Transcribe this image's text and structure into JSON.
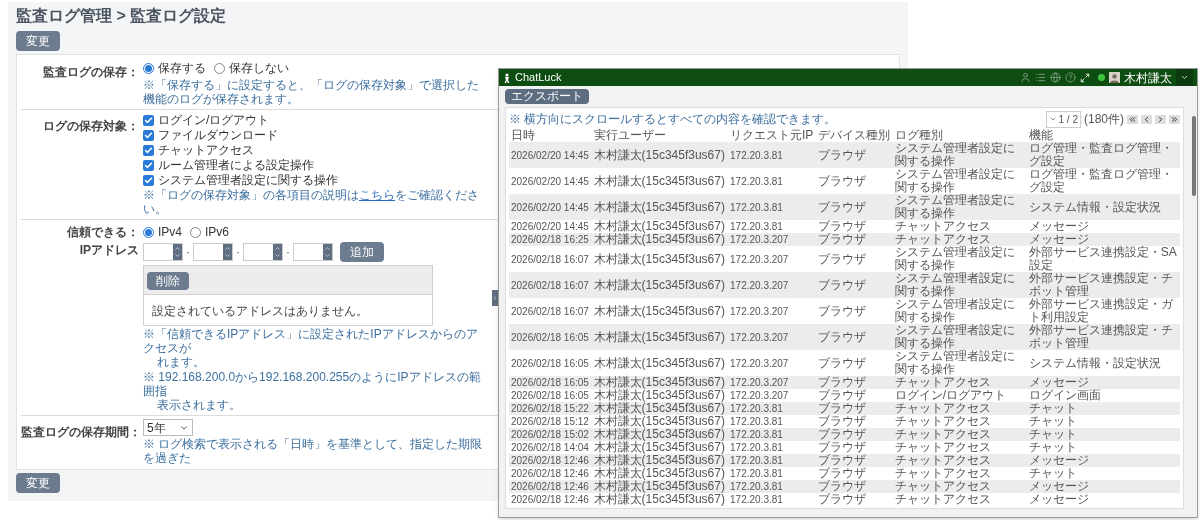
{
  "settings": {
    "title": "監査ログ管理 > 監査ログ設定",
    "top_button": "変更",
    "bottom_button": "変更",
    "save": {
      "label": "監査ログの保存：",
      "options": [
        {
          "label": "保存する",
          "selected": true
        },
        {
          "label": "保存しない",
          "selected": false
        }
      ],
      "note": "※「保存する」に設定すると、「ログの保存対象」で選択した機能のログが保存されます。"
    },
    "targets": {
      "label": "ログの保存対象：",
      "items": [
        {
          "label": "ログイン/ログアウト",
          "checked": true
        },
        {
          "label": "ファイルダウンロード",
          "checked": true
        },
        {
          "label": "チャットアクセス",
          "checked": true
        },
        {
          "label": "ルーム管理者による設定操作",
          "checked": true
        },
        {
          "label": "システム管理者設定に関する操作",
          "checked": true
        }
      ],
      "note": {
        "before": "※「ログの保存対象」の各項目の説明は",
        "link": "こちら",
        "after": "をご確認ください。"
      }
    },
    "ip": {
      "label_lines": [
        "信頼できる：",
        "IPアドレス"
      ],
      "options": [
        {
          "label": "IPv4",
          "selected": true
        },
        {
          "label": "IPv6",
          "selected": false
        }
      ],
      "separators": [
        "·",
        "·",
        "·"
      ],
      "add_button": "追加",
      "delete_button": "削除",
      "empty_message": "設定されているアドレスはありません。",
      "notes": [
        [
          "※「信頼できるIPアドレス」に設定されたIPアドレスからのアクセスが",
          "れます。"
        ],
        [
          "※ 192.168.200.0から192.168.200.255のようにIPアドレスの範囲指",
          "表示されます。"
        ]
      ]
    },
    "period": {
      "label": "監査ログの保存期間：",
      "value": "5年",
      "note": "※ ログ検索で表示される「日時」を基準として、指定した期限を過ぎた"
    }
  },
  "window": {
    "app_name": "ChatLuck",
    "user_name": "木村謙太",
    "export_button": "エクスポート",
    "scroll_note": "※ 横方向にスクロールするとすべての内容を確認できます。",
    "page_select": "1 / 2",
    "total": "(180件)",
    "table": {
      "columns": [
        "日時",
        "実行ユーザー",
        "リクエスト元IP",
        "デバイス種別",
        "ログ種別",
        "機能"
      ],
      "rows": [
        {
          "cells": [
            "2026/02/20 14:45",
            "木村謙太(15c345f3us67)",
            "172.20.3.81",
            "ブラウザ",
            "システム管理者設定に関する操作"
          ],
          "function": [
            "ログ管理・監査ログ管理・",
            "グ設定"
          ]
        },
        {
          "cells": [
            "2026/02/20 14:45",
            "木村謙太(15c345f3us67)",
            "172.20.3.81",
            "ブラウザ",
            "システム管理者設定に関する操作"
          ],
          "function": [
            "ログ管理・監査ログ管理・",
            "グ設定"
          ]
        },
        {
          "cells": [
            "2026/02/20 14:45",
            "木村謙太(15c345f3us67)",
            "172.20.3.81",
            "ブラウザ",
            "システム管理者設定に関する操作"
          ],
          "function": [
            "システム情報・設定状況"
          ]
        },
        {
          "cells": [
            "2026/02/20 14:45",
            "木村謙太(15c345f3us67)",
            "172.20.3.81",
            "ブラウザ",
            "チャットアクセス"
          ],
          "function": [
            "メッセージ"
          ]
        },
        {
          "cells": [
            "2026/02/18 16:25",
            "木村謙太(15c345f3us67)",
            "172.20.3.207",
            "ブラウザ",
            "チャットアクセス"
          ],
          "function": [
            "メッセージ"
          ]
        },
        {
          "cells": [
            "2026/02/18 16:07",
            "木村謙太(15c345f3us67)",
            "172.20.3.207",
            "ブラウザ",
            "システム管理者設定に関する操作"
          ],
          "function": [
            "外部サービス連携設定・SA",
            "設定"
          ]
        },
        {
          "cells": [
            "2026/02/18 16:07",
            "木村謙太(15c345f3us67)",
            "172.20.3.207",
            "ブラウザ",
            "システム管理者設定に関する操作"
          ],
          "function": [
            "外部サービス連携設定・チ",
            "ボット管理"
          ]
        },
        {
          "cells": [
            "2026/02/18 16:07",
            "木村謙太(15c345f3us67)",
            "172.20.3.207",
            "ブラウザ",
            "システム管理者設定に関する操作"
          ],
          "function": [
            "外部サービス連携設定・ガ",
            "ト利用設定"
          ]
        },
        {
          "cells": [
            "2026/02/18 16:05",
            "木村謙太(15c345f3us67)",
            "172.20.3.207",
            "ブラウザ",
            "システム管理者設定に関する操作"
          ],
          "function": [
            "外部サービス連携設定・チ",
            "ボット管理"
          ]
        },
        {
          "cells": [
            "2026/02/18 16:05",
            "木村謙太(15c345f3us67)",
            "172.20.3.207",
            "ブラウザ",
            "システム管理者設定に関する操作"
          ],
          "function": [
            "システム情報・設定状況"
          ]
        },
        {
          "cells": [
            "2026/02/18 16:05",
            "木村謙太(15c345f3us67)",
            "172.20.3.207",
            "ブラウザ",
            "チャットアクセス"
          ],
          "function": [
            "メッセージ"
          ]
        },
        {
          "cells": [
            "2026/02/18 16:05",
            "木村謙太(15c345f3us67)",
            "172.20.3.207",
            "ブラウザ",
            "ログイン/ログアウト"
          ],
          "function": [
            "ログイン画面"
          ]
        },
        {
          "cells": [
            "2026/02/18 15:22",
            "木村謙太(15c345f3us67)",
            "172.20.3.81",
            "ブラウザ",
            "チャットアクセス"
          ],
          "function": [
            "チャット"
          ]
        },
        {
          "cells": [
            "2026/02/18 15:12",
            "木村謙太(15c345f3us67)",
            "172.20.3.81",
            "ブラウザ",
            "チャットアクセス"
          ],
          "function": [
            "チャット"
          ]
        },
        {
          "cells": [
            "2026/02/18 15:02",
            "木村謙太(15c345f3us67)",
            "172.20.3.81",
            "ブラウザ",
            "チャットアクセス"
          ],
          "function": [
            "チャット"
          ]
        },
        {
          "cells": [
            "2026/02/18 14:04",
            "木村謙太(15c345f3us67)",
            "172.20.3.81",
            "ブラウザ",
            "チャットアクセス"
          ],
          "function": [
            "チャット"
          ]
        },
        {
          "cells": [
            "2026/02/18 12:46",
            "木村謙太(15c345f3us67)",
            "172.20.3.81",
            "ブラウザ",
            "チャットアクセス"
          ],
          "function": [
            "メッセージ"
          ]
        },
        {
          "cells": [
            "2026/02/18 12:46",
            "木村謙太(15c345f3us67)",
            "172.20.3.81",
            "ブラウザ",
            "チャットアクセス"
          ],
          "function": [
            "チャット"
          ]
        },
        {
          "cells": [
            "2026/02/18 12:46",
            "木村謙太(15c345f3us67)",
            "172.20.3.81",
            "ブラウザ",
            "チャットアクセス"
          ],
          "function": [
            "メッセージ"
          ]
        },
        {
          "cells": [
            "2026/02/18 12:46",
            "木村謙太(15c345f3us67)",
            "172.20.3.81",
            "ブラウザ",
            "チャットアクセス"
          ],
          "function": [
            "メッセージ"
          ]
        }
      ]
    }
  }
}
